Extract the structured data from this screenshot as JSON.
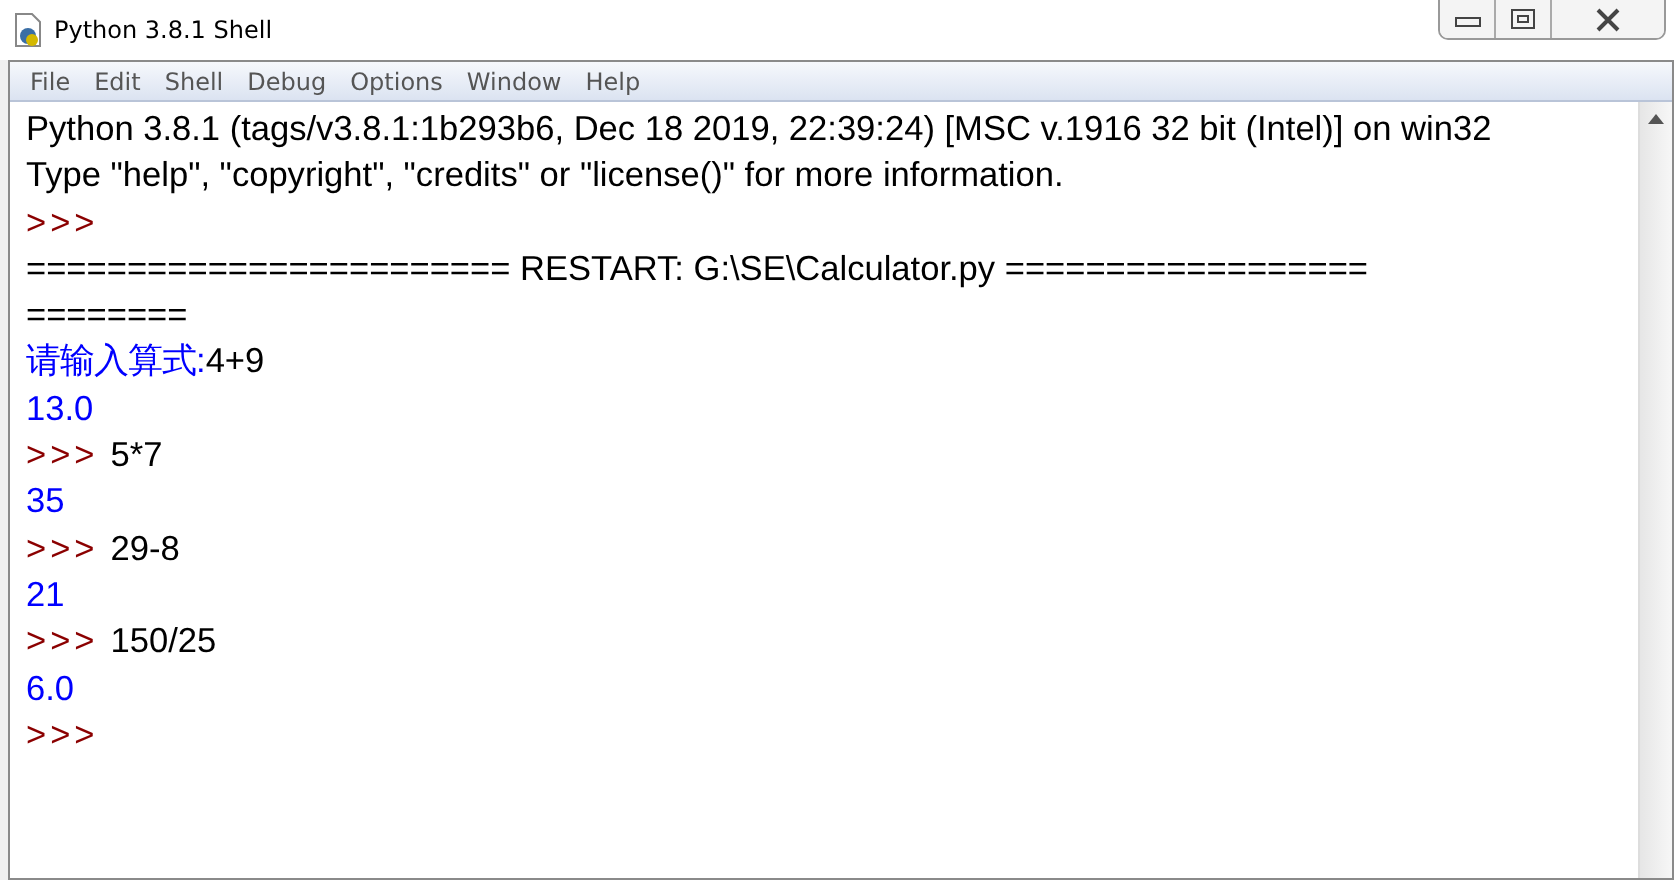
{
  "window": {
    "title": "Python 3.8.1 Shell"
  },
  "menu": [
    "File",
    "Edit",
    "Shell",
    "Debug",
    "Options",
    "Window",
    "Help"
  ],
  "lines": [
    [
      {
        "kind": "output",
        "text": "Python 3.8.1 (tags/v3.8.1:1b293b6, Dec 18 2019, 22:39:24) [MSC v.1916 32 bit (Intel)] on win32"
      }
    ],
    [
      {
        "kind": "output",
        "text": "Type \"help\", \"copyright\", \"credits\" or \"license()\" for more information."
      }
    ],
    [
      {
        "kind": "prompt",
        "text": ">>>"
      }
    ],
    [
      {
        "kind": "output",
        "text": "======================== RESTART: G:\\SE\\Calculator.py =================="
      }
    ],
    [
      {
        "kind": "output",
        "text": "========"
      }
    ],
    [
      {
        "kind": "stdout",
        "text": "请输入算式:"
      },
      {
        "kind": "input",
        "text": "4+9"
      }
    ],
    [
      {
        "kind": "stdout",
        "text": "13.0"
      }
    ],
    [
      {
        "kind": "prompt",
        "text": ">>>"
      },
      {
        "kind": "input",
        "text": "5*7"
      }
    ],
    [
      {
        "kind": "stdout",
        "text": "35"
      }
    ],
    [
      {
        "kind": "prompt",
        "text": ">>>"
      },
      {
        "kind": "input",
        "text": "29-8"
      }
    ],
    [
      {
        "kind": "stdout",
        "text": "21"
      }
    ],
    [
      {
        "kind": "prompt",
        "text": ">>>"
      },
      {
        "kind": "input",
        "text": "150/25"
      }
    ],
    [
      {
        "kind": "stdout",
        "text": "6.0"
      }
    ],
    [
      {
        "kind": "prompt",
        "text": ">>>"
      }
    ]
  ]
}
